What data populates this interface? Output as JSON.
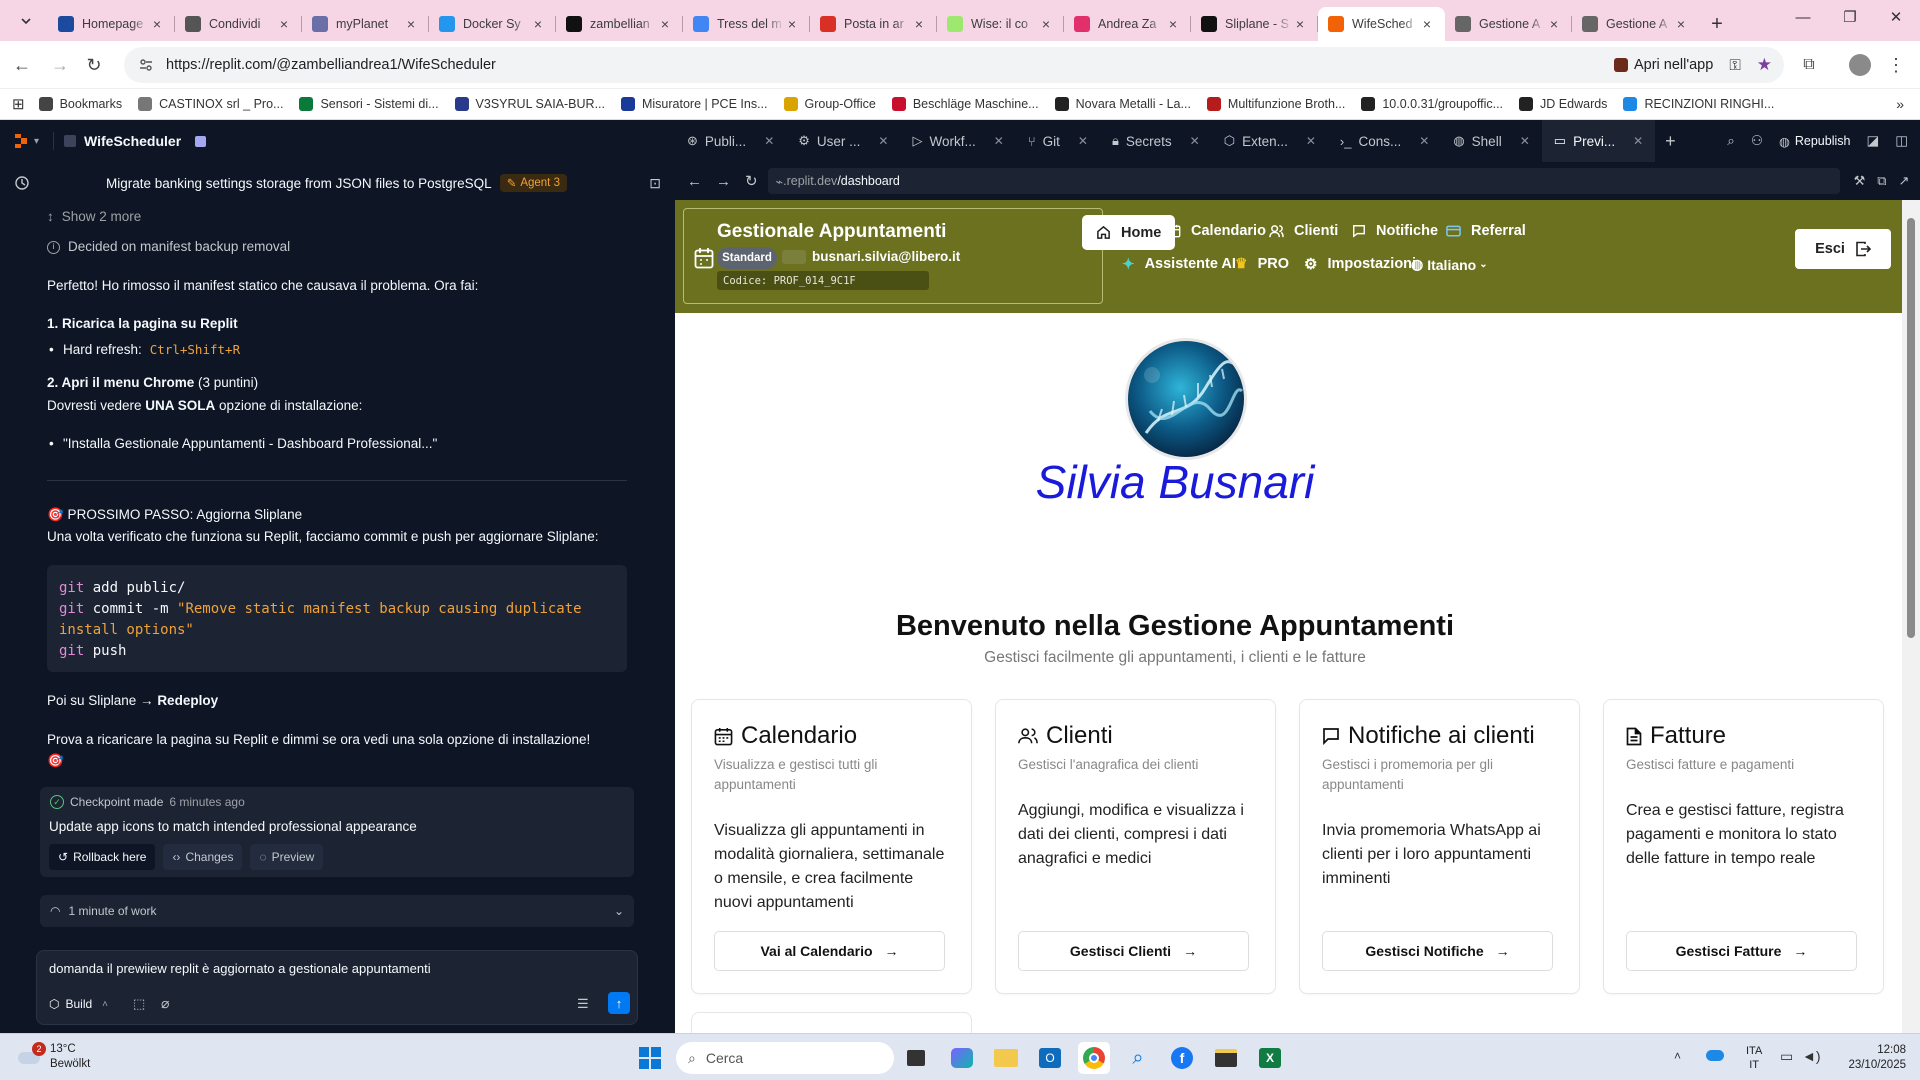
{
  "browser": {
    "tabs": [
      {
        "title": "Homepage",
        "favicon_color": "#1c4a9e",
        "active": false
      },
      {
        "title": "Condividi",
        "favicon_color": "#555555",
        "active": false
      },
      {
        "title": "myPlanet",
        "favicon_color": "#6a6fa8",
        "active": false
      },
      {
        "title": "Docker Sy",
        "favicon_color": "#2496ed",
        "active": false
      },
      {
        "title": "zambellian",
        "favicon_color": "#111111",
        "active": false
      },
      {
        "title": "Tress del m",
        "favicon_color": "#4285f4",
        "active": false
      },
      {
        "title": "Posta in ar",
        "favicon_color": "#d93025",
        "active": false
      },
      {
        "title": "Wise: il co",
        "favicon_color": "#9fe870",
        "active": false
      },
      {
        "title": "Andrea Za",
        "favicon_color": "#e1306c",
        "active": false
      },
      {
        "title": "Sliplane - S",
        "favicon_color": "#111111",
        "active": false
      },
      {
        "title": "WifeSched",
        "favicon_color": "#f26207",
        "active": true
      },
      {
        "title": "Gestione A",
        "favicon_color": "#666666",
        "active": false
      },
      {
        "title": "Gestione A",
        "favicon_color": "#666666",
        "active": false
      }
    ],
    "url": "https://replit.com/@zambelliandrea1/WifeScheduler",
    "open_app_label": "Apri nell'app",
    "bookmarks": [
      {
        "label": "Bookmarks",
        "favicon_color": "#444444"
      },
      {
        "label": "CASTINOX srl _ Pro...",
        "favicon_color": "#777777"
      },
      {
        "label": "Sensori - Sistemi di...",
        "favicon_color": "#0a7a3a"
      },
      {
        "label": "V3SYRUL SAIA-BUR...",
        "favicon_color": "#2a3a8a"
      },
      {
        "label": "Misuratore | PCE Ins...",
        "favicon_color": "#1a3a9a"
      },
      {
        "label": "Group-Office",
        "favicon_color": "#d9a400"
      },
      {
        "label": "Beschläge Maschine...",
        "favicon_color": "#c8102e"
      },
      {
        "label": "Novara Metalli - La...",
        "favicon_color": "#222222"
      },
      {
        "label": "Multifunzione Broth...",
        "favicon_color": "#b71c1c"
      },
      {
        "label": "10.0.0.31/groupoffic...",
        "favicon_color": "#222222"
      },
      {
        "label": "JD Edwards",
        "favicon_color": "#222222"
      },
      {
        "label": "RECINZIONI RINGHI...",
        "favicon_color": "#1e88e5"
      }
    ]
  },
  "replit": {
    "project_name": "WifeScheduler",
    "chat_title": "Migrate banking settings storage from JSON files to PostgreSQL",
    "agent_badge": "Agent 3",
    "show_more": "Show 2 more",
    "decided": "Decided on manifest backup removal",
    "msg_intro": "Perfetto! Ho rimosso il manifest statico che causava il problema. Ora fai:",
    "step1_title": "1. Ricarica la pagina su Replit",
    "step1_bullet_label": "Hard refresh:",
    "step1_bullet_code": "Ctrl+Shift+R",
    "step2_title": "2. Apri il menu Chrome",
    "step2_suffix": " (3 puntini)",
    "step2_line_pre": "Dovresti vedere ",
    "step2_line_bold": "UNA SOLA",
    "step2_line_post": " opzione di installazione:",
    "step2_bullet": "\"Installa Gestionale Appuntamenti - Dashboard Professional...\"",
    "next_title": "🎯 PROSSIMO PASSO: Aggiorna Sliplane",
    "next_text": "Una volta verificato che funziona su Replit, facciamo commit e push per aggiornare Sliplane:",
    "code_lines": [
      "git add public/",
      "git commit -m \"Remove static manifest backup causing duplicate",
      "install options\"",
      "git push"
    ],
    "then_pre": "Poi su Sliplane → ",
    "then_bold": "Redeploy",
    "final_line1": "Prova a ricaricare la pagina su Replit e dimmi se ora vedi una sola opzione di installazione!",
    "final_emoji": "🎯",
    "checkpoint_label": "Checkpoint made",
    "checkpoint_time": "6 minutes ago",
    "checkpoint_desc": "Update app icons to match intended professional appearance",
    "rollback": "Rollback here",
    "changes": "Changes",
    "preview": "Preview",
    "work_time": "1 minute of work",
    "input_text": "domanda il prewiiew replit è aggiornato a gestionale appuntamenti",
    "build_label": "Build",
    "tabs": [
      {
        "label": "Publi...",
        "icon": "publish-icon",
        "closable": true
      },
      {
        "label": "User ...",
        "icon": "gear-icon",
        "closable": true
      },
      {
        "label": "Workf...",
        "icon": "play-icon",
        "closable": true
      },
      {
        "label": "Git",
        "icon": "git-icon",
        "closable": true
      },
      {
        "label": "Secrets",
        "icon": "lock-icon",
        "closable": true
      },
      {
        "label": "Exten...",
        "icon": "puzzle-icon",
        "closable": true
      },
      {
        "label": "Cons...",
        "icon": "console-icon",
        "closable": true
      },
      {
        "label": "Shell",
        "icon": "shell-icon",
        "closable": true
      },
      {
        "label": "Previ...",
        "icon": "monitor-icon",
        "closable": true,
        "active": true
      }
    ],
    "republish": "Republish",
    "preview_url_prefix": ".replit.dev",
    "preview_url_path": "/dashboard"
  },
  "app": {
    "brand_title": "Gestionale Appuntamenti",
    "plan_badge": "Standard",
    "email": "busnari.silvia@libero.it",
    "code_label": "Codice: PROF_014_9C1F",
    "nav": {
      "home": "Home",
      "calendar": "Calendario",
      "clients": "Clienti",
      "notifications": "Notifiche",
      "referral": "Referral",
      "assistant": "Assistente AI",
      "pro": "PRO",
      "settings": "Impostazioni",
      "language": "Italiano"
    },
    "logout": "Esci",
    "user_name": "Silvia Busnari",
    "welcome_title": "Benvenuto nella Gestione Appuntamenti",
    "welcome_subtitle": "Gestisci facilmente gli appuntamenti, i clienti e le fatture",
    "cards": [
      {
        "title": "Calendario",
        "subtitle": "Visualizza e gestisci tutti gli appuntamenti",
        "body": "Visualizza gli appuntamenti in modalità giornaliera, settimanale o mensile, e crea facilmente nuovi appuntamenti",
        "button": "Vai al Calendario"
      },
      {
        "title": "Clienti",
        "subtitle": "Gestisci l'anagrafica dei clienti",
        "body": "Aggiungi, modifica e visualizza i dati dei clienti, compresi i dati anagrafici e medici",
        "button": "Gestisci Clienti"
      },
      {
        "title": "Notifiche ai clienti",
        "subtitle": "Gestisci i promemoria per gli appuntamenti",
        "body": "Invia promemoria WhatsApp ai clienti per i loro appuntamenti imminenti",
        "button": "Gestisci Notifiche"
      },
      {
        "title": "Fatture",
        "subtitle": "Gestisci fatture e pagamenti",
        "body": "Crea e gestisci fatture, registra pagamenti e monitora lo stato delle fatture in tempo reale",
        "button": "Gestisci Fatture"
      }
    ],
    "colors": {
      "header": "#6b711f",
      "name": "#1a1adb"
    }
  },
  "taskbar": {
    "weather_badge": "2",
    "weather_temp": "13°C",
    "weather_desc": "Bewölkt",
    "search_placeholder": "Cerca",
    "lang_1": "ITA",
    "lang_2": "IT",
    "time": "12:08",
    "date": "23/10/2025"
  }
}
